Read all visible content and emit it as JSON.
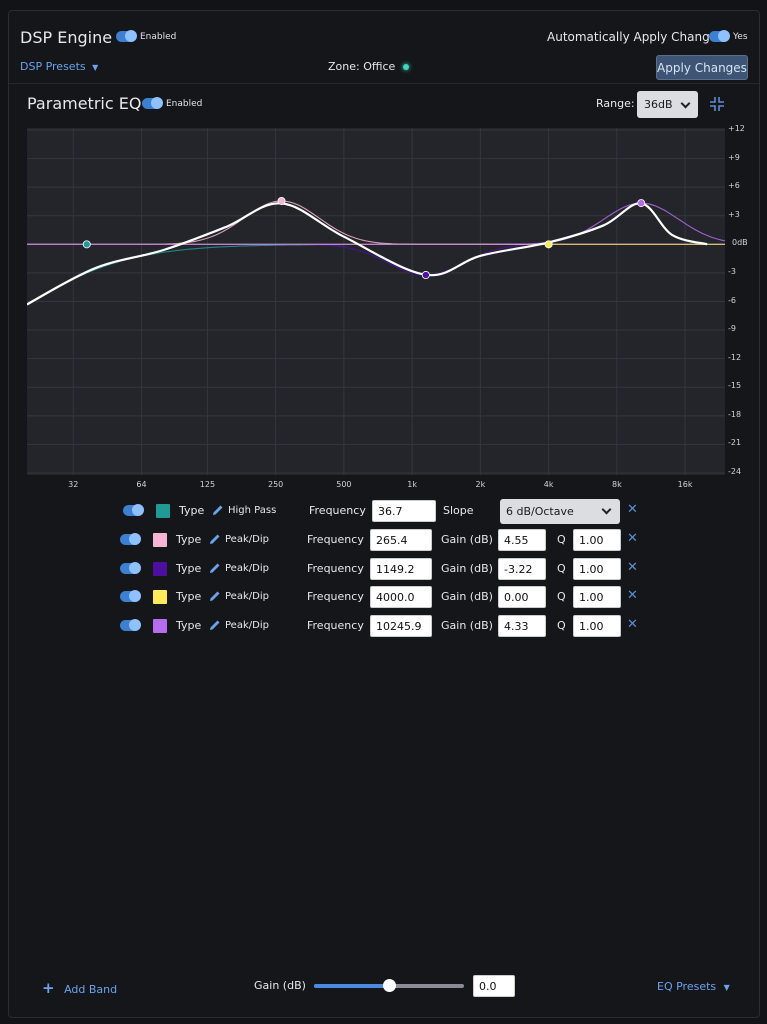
{
  "header": {
    "title": "DSP Engine",
    "enabled_label": "Enabled",
    "auto_apply_label": "Automatically Apply Changes",
    "auto_apply_value": "Yes",
    "presets_label": "DSP Presets",
    "zone_label": "Zone: Office",
    "apply_button": "Apply Changes"
  },
  "eq": {
    "title": "Parametric EQ",
    "enabled_label": "Enabled",
    "range_label": "Range:",
    "range_value": "36dB"
  },
  "chart_data": {
    "type": "line",
    "x_scale": "log",
    "xlim": [
      20,
      24000
    ],
    "ylim": [
      -24,
      12
    ],
    "x_ticks": [
      "32",
      "64",
      "125",
      "250",
      "500",
      "1k",
      "2k",
      "4k",
      "8k",
      "16k"
    ],
    "x_tick_values": [
      32,
      64,
      125,
      250,
      500,
      1000,
      2000,
      4000,
      8000,
      16000
    ],
    "y_ticks": [
      "+12",
      "+9",
      "+6",
      "+3",
      "0dB",
      "-3",
      "-6",
      "-9",
      "-12",
      "-15",
      "-18",
      "-21",
      "-24"
    ],
    "y_tick_values": [
      12,
      9,
      6,
      3,
      0,
      -3,
      -6,
      -9,
      -12,
      -15,
      -18,
      -21,
      -24
    ],
    "grid": true,
    "bands": [
      {
        "type": "high-pass",
        "freq": 36.7,
        "color": "#1f9a94"
      },
      {
        "type": "peak",
        "freq": 265.4,
        "gain": 4.55,
        "q": 1.0,
        "color": "#f5b5d6"
      },
      {
        "type": "peak",
        "freq": 1149.2,
        "gain": -3.22,
        "q": 1.0,
        "color": "#4c0fa0"
      },
      {
        "type": "peak",
        "freq": 4000.0,
        "gain": 0.0,
        "q": 1.0,
        "color": "#ffea5c"
      },
      {
        "type": "peak",
        "freq": 10245.9,
        "gain": 4.33,
        "q": 1.0,
        "color": "#b76cf0"
      }
    ],
    "combined_curve": {
      "color": "#ffffff",
      "x": [
        20,
        40,
        80,
        150,
        265.4,
        500,
        1149.2,
        2000,
        4000,
        7000,
        10245.9,
        14000,
        20000
      ],
      "y": [
        -6.3,
        -2.5,
        -0.6,
        1.8,
        4.3,
        0.8,
        -3.2,
        -1.2,
        0.2,
        2.0,
        4.3,
        1.0,
        0
      ]
    }
  },
  "bands": [
    {
      "color": "#1f9a94",
      "type_label": "Type",
      "type_value": "High Pass",
      "freq_label": "Frequency",
      "freq": "36.7",
      "param_label": "Slope",
      "param": "6 dB/Octave",
      "q_label": "",
      "q": ""
    },
    {
      "color": "#f5b5d6",
      "type_label": "Type",
      "type_value": "Peak/Dip",
      "freq_label": "Frequency",
      "freq": "265.4",
      "param_label": "Gain (dB)",
      "param": "4.55",
      "q_label": "Q",
      "q": "1.00"
    },
    {
      "color": "#4c0fa0",
      "type_label": "Type",
      "type_value": "Peak/Dip",
      "freq_label": "Frequency",
      "freq": "1149.2",
      "param_label": "Gain (dB)",
      "param": "-3.22",
      "q_label": "Q",
      "q": "1.00"
    },
    {
      "color": "#ffea5c",
      "type_label": "Type",
      "type_value": "Peak/Dip",
      "freq_label": "Frequency",
      "freq": "4000.0",
      "param_label": "Gain (dB)",
      "param": "0.00",
      "q_label": "Q",
      "q": "1.00"
    },
    {
      "color": "#b76cf0",
      "type_label": "Type",
      "type_value": "Peak/Dip",
      "freq_label": "Frequency",
      "freq": "10245.9",
      "param_label": "Gain (dB)",
      "param": "4.33",
      "q_label": "Q",
      "q": "1.00"
    }
  ],
  "footer": {
    "add_band": "Add Band",
    "gain_label": "Gain (dB)",
    "gain_value": "0.0",
    "gain_slider_fraction": 0.5,
    "eq_presets": "EQ Presets"
  }
}
